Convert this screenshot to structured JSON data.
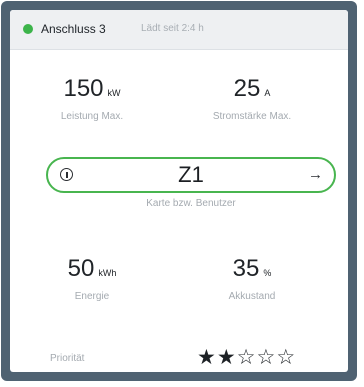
{
  "header": {
    "connector_label": "Anschluss 3",
    "status_text": "Lädt seit 2:4 h",
    "status_color": "#3cb44a"
  },
  "metrics": {
    "power": {
      "value": "150",
      "unit": "kW",
      "label": "Leistung Max."
    },
    "current": {
      "value": "25",
      "unit": "A",
      "label": "Stromstärke Max."
    },
    "energy": {
      "value": "50",
      "unit": "kWh",
      "label": "Energie"
    },
    "battery": {
      "value": "35",
      "unit": "%",
      "label": "Akkustand"
    }
  },
  "user_selector": {
    "value": "Z1",
    "sublabel": "Karte bzw. Benutzer",
    "info_icon": "info-circle-icon",
    "arrow_icon": "arrow-right-icon",
    "accent_color": "#48b54f"
  },
  "priority": {
    "label": "Priorität",
    "rating": 2,
    "max": 5
  }
}
